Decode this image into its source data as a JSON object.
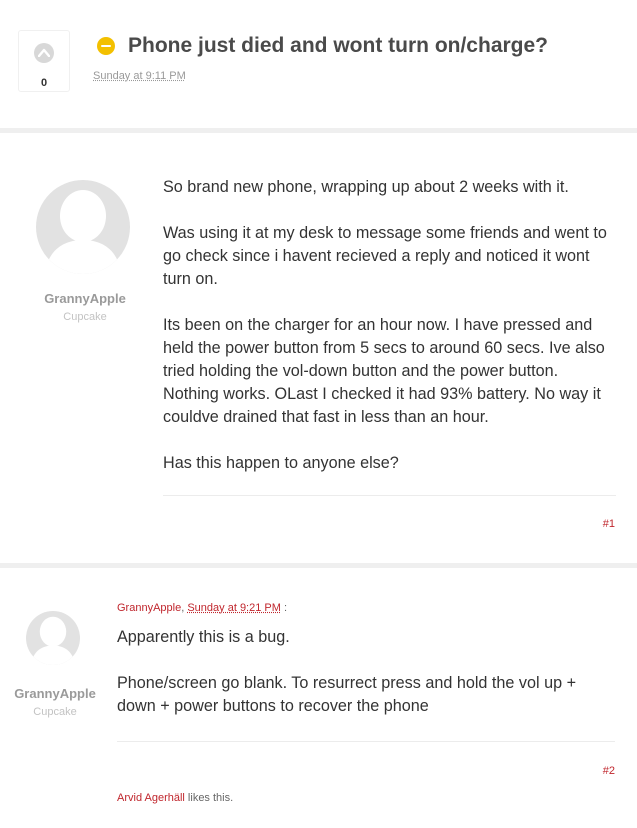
{
  "thread": {
    "vote_count": "0",
    "title": "Phone just died and wont turn on/charge?",
    "date": "Sunday at 9:11 PM"
  },
  "posts": [
    {
      "username": "GrannyApple",
      "user_title": "Cupcake",
      "paragraphs": [
        "So brand new phone, wrapping up about 2 weeks with it.",
        "Was using it at my desk to message some friends and went to go check since i havent recieved a reply and noticed it wont turn on.",
        "Its been on the charger for an hour now. I have pressed and held the power button from 5 secs to around 60 secs. Ive also tried holding the vol-down button and the power button. Nothing works. OLast I checked it had 93% battery. No way it couldve drained that fast in less than an hour.",
        "Has this happen to anyone else?"
      ],
      "permalink": "#1"
    },
    {
      "username": "GrannyApple",
      "user_title": "Cupcake",
      "quote_user": "GrannyApple",
      "quote_sep": ", ",
      "quote_date": "Sunday at 9:21 PM",
      "quote_suffix": " :",
      "paragraphs": [
        "Apparently this is a bug.",
        "Phone/screen go blank. To resurrect press and hold the vol up + down + power buttons to recover the phone"
      ],
      "permalink": "#2",
      "likes_user": "Arvid Agerhäll",
      "likes_text": " likes this."
    }
  ],
  "colors": {
    "accent": "#c0262d",
    "status": "#f3c000",
    "muted": "#9a9a9a"
  },
  "icons": {
    "vote": "chevron-up-icon",
    "status": "minus-circle-icon",
    "avatar": "default-avatar-icon"
  }
}
